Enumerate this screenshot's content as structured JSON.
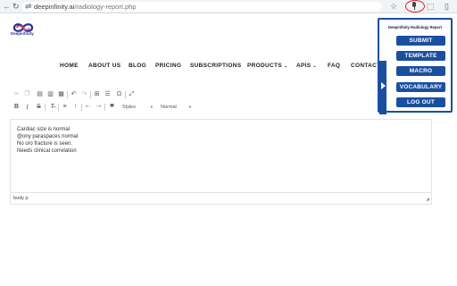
{
  "browser": {
    "url_host": "deepinfinity.ai",
    "url_path": "/radiology-report.php",
    "icons": [
      "back-icon",
      "forward-icon",
      "reload-icon",
      "site-info-icon",
      "bookmark-star-icon",
      "microphone-extension-icon",
      "extensions-icon",
      "sidebar-icon"
    ]
  },
  "site": {
    "logo_text": "Deepinfinity",
    "nav": [
      {
        "label": "HOME",
        "dropdown": false
      },
      {
        "label": "ABOUT US",
        "dropdown": false
      },
      {
        "label": "BLOG",
        "dropdown": false
      },
      {
        "label": "PRICING",
        "dropdown": false
      },
      {
        "label": "SUBSCRIPTIONS",
        "dropdown": false
      },
      {
        "label": "PRODUCTS",
        "dropdown": true
      },
      {
        "label": "APIS",
        "dropdown": true
      },
      {
        "label": "FAQ",
        "dropdown": false
      },
      {
        "label": "CONTACT",
        "dropdown": false
      }
    ]
  },
  "editor": {
    "toolbar_row1": [
      "cut-icon",
      "copy-icon",
      "paste-icon",
      "paste-text-icon",
      "paste-word-icon",
      "undo-icon",
      "redo-icon",
      "table-icon",
      "horizontal-line-icon",
      "special-char-icon",
      "maximize-icon"
    ],
    "toolbar_row2": [
      "bold-icon",
      "italic-icon",
      "strike-icon",
      "remove-format-icon",
      "numbered-list-icon",
      "bulleted-list-icon",
      "outdent-icon",
      "indent-icon",
      "blockquote-icon"
    ],
    "styles_combo": "Styles",
    "format_combo": "Normal",
    "lines": [
      "Cardiac size is normal",
      "@ony paraspaces normal",
      "No o/o fracture is seen.",
      "Needs clinical correlation"
    ],
    "status_path": "body  p"
  },
  "popup": {
    "title": "Deepinfinity Radiology Report",
    "buttons": [
      "SUBMIT",
      "TEMPLATE",
      "MACRO",
      "VOCABULARY",
      "LOG OUT"
    ]
  },
  "colors": {
    "popup_blue": "#1a4fa0",
    "extension_ring": "#d8262b"
  }
}
